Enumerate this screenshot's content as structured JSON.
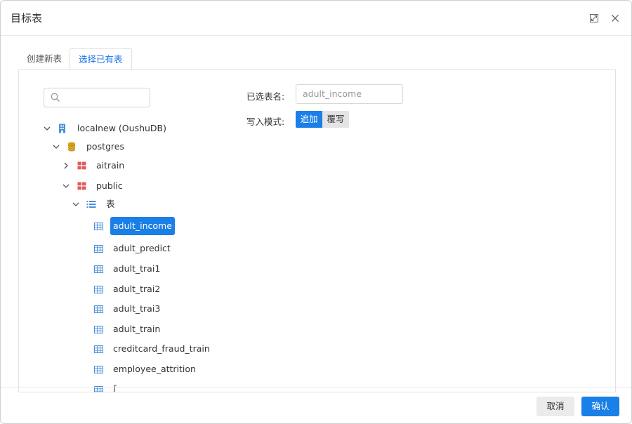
{
  "dialog": {
    "title": "目标表"
  },
  "tabs": [
    {
      "label": "创建新表",
      "active": false
    },
    {
      "label": "选择已有表",
      "active": true
    }
  ],
  "search": {
    "value": "",
    "placeholder": ""
  },
  "tree": {
    "nodes": [
      {
        "label": "localnew (OushuDB)",
        "icon": "server-icon",
        "expanded": true
      },
      {
        "label": "postgres",
        "icon": "database-icon",
        "expanded": true
      },
      {
        "label": "aitrain",
        "icon": "schema-icon",
        "expanded": false
      },
      {
        "label": "public",
        "icon": "schema-icon",
        "expanded": true
      },
      {
        "label": "表",
        "icon": "list-icon",
        "expanded": true
      },
      {
        "label": "adult_income",
        "icon": "table-icon",
        "selected": true
      },
      {
        "label": "adult_predict",
        "icon": "table-icon"
      },
      {
        "label": "adult_trai1",
        "icon": "table-icon"
      },
      {
        "label": "adult_trai2",
        "icon": "table-icon"
      },
      {
        "label": "adult_trai3",
        "icon": "table-icon"
      },
      {
        "label": "adult_train",
        "icon": "table-icon"
      },
      {
        "label": "creditcard_fraud_train",
        "icon": "table-icon"
      },
      {
        "label": "employee_attrition",
        "icon": "table-icon"
      },
      {
        "label": "f",
        "icon": "table-icon"
      }
    ]
  },
  "form": {
    "selected_table_label": "已选表名:",
    "selected_table_value": "adult_income",
    "write_mode_label": "写入模式:",
    "mode_append": "追加",
    "mode_overwrite": "覆写"
  },
  "footer": {
    "cancel_label": "取消",
    "confirm_label": "确认"
  },
  "colors": {
    "accent": "#1a7fe6",
    "table_icon": "#4a90d9",
    "schema_icon": "#e05a5a",
    "database_icon": "#d4a017"
  }
}
